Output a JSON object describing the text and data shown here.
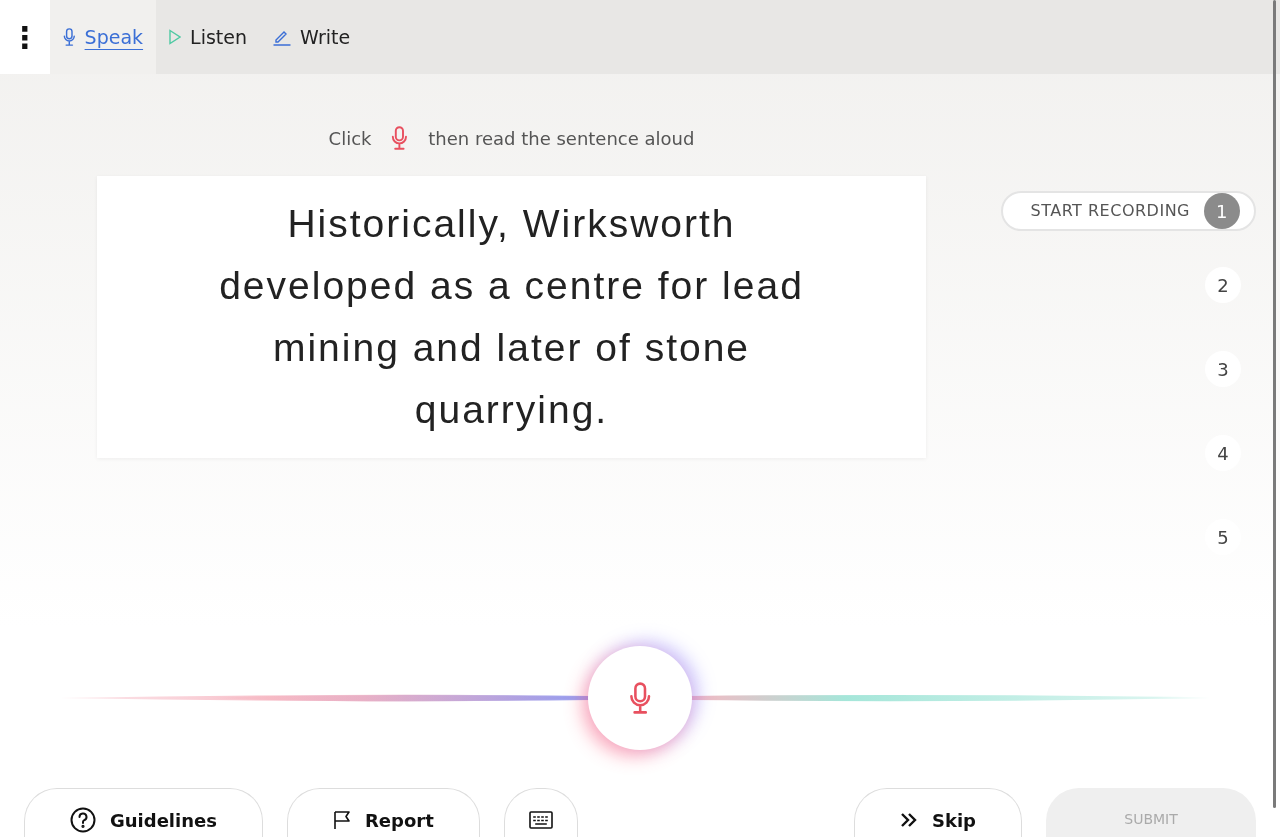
{
  "menu": {
    "label": "⋮"
  },
  "tabs": [
    {
      "label": "Speak",
      "kind": "mic",
      "selected": true
    },
    {
      "label": "Listen",
      "kind": "play",
      "selected": false
    },
    {
      "label": "Write",
      "kind": "pen",
      "selected": false
    }
  ],
  "instruction": {
    "before": "Click",
    "after": "then read the sentence aloud"
  },
  "sentence": "Historically, Wirksworth developed as a centre for lead mining and later of stone quarrying.",
  "steps": [
    {
      "number": "1",
      "label": "START RECORDING",
      "selected": true
    },
    {
      "number": "2",
      "selected": false
    },
    {
      "number": "3",
      "selected": false
    },
    {
      "number": "4",
      "selected": false
    },
    {
      "number": "5",
      "selected": false
    }
  ],
  "footer": {
    "left": [
      {
        "kind": "help",
        "label": "Guidelines"
      },
      {
        "kind": "flag",
        "label": "Report"
      },
      {
        "kind": "keyboard"
      }
    ],
    "skip": {
      "label": "Skip"
    },
    "submit": {
      "label": "SUBMIT",
      "disabled": true
    }
  }
}
